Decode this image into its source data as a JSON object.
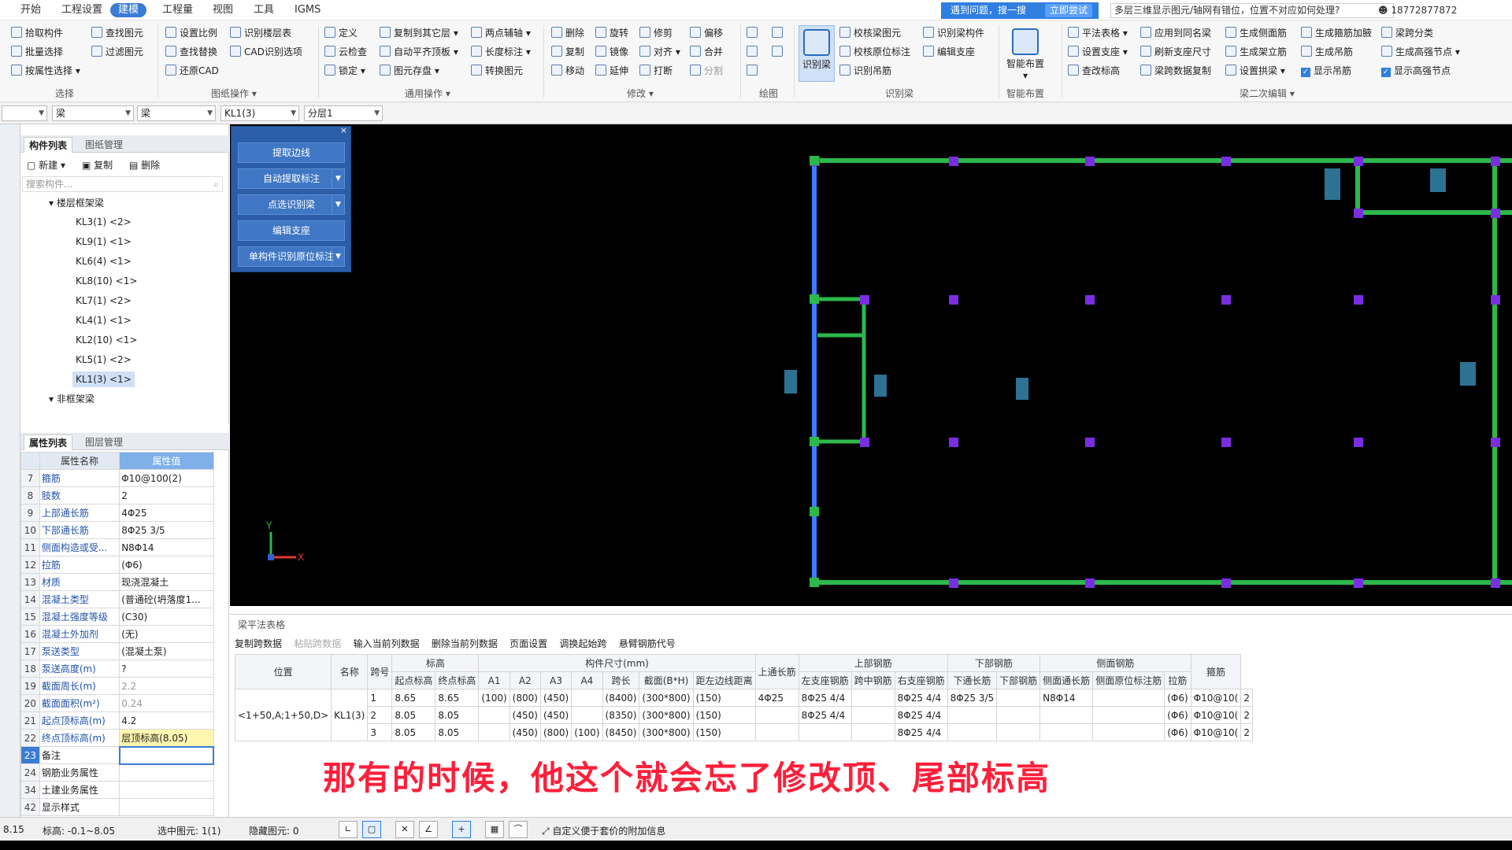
{
  "menu": [
    "开始",
    "工程设置",
    "建模",
    "工程量",
    "视图",
    "工具",
    "IGMS"
  ],
  "help": {
    "text": "遇到问题，搜一搜",
    "try_now": "立即尝试",
    "search": "多层三维显示图元/轴网有错位，位置不对应如何处理?",
    "phone": "18772877872"
  },
  "ribbon": {
    "select": {
      "items": [
        "拾取构件",
        "批量选择",
        "按属性选择",
        "查找图元",
        "过滤图元"
      ],
      "label": "选择"
    },
    "drawing": {
      "items": [
        "设置比例",
        "查找替换",
        "还原CAD",
        "识别楼层表",
        "CAD识别选项"
      ],
      "label": "图纸操作"
    },
    "general": {
      "items": [
        "定义",
        "云检查",
        "锁定",
        "复制到其它层",
        "自动平齐顶板",
        "图元存盘",
        "两点辅轴",
        "长度标注",
        "转换图元"
      ],
      "label": "通用操作"
    },
    "modify": {
      "items": [
        "删除",
        "复制",
        "移动",
        "旋转",
        "镜像",
        "延伸",
        "修剪",
        "对齐",
        "打断",
        "偏移",
        "合并",
        "分割"
      ],
      "label": "修改"
    },
    "draw": {
      "label": "绘图"
    },
    "recognize": {
      "big": "识别梁",
      "items": [
        "校核梁图元",
        "校核原位标注",
        "识别吊筋",
        "识别梁构件",
        "编辑支座"
      ],
      "label": "识别梁"
    },
    "smart": {
      "big": "智能布置",
      "label": "智能布置"
    },
    "beam2": {
      "items": [
        "平法表格",
        "设置支座",
        "查改标高",
        "应用到同名梁",
        "刷新支座尺寸",
        "梁跨数据复制",
        "生成侧面筋",
        "生成架立筋",
        "设置拱梁",
        "生成箍筋加腋",
        "生成吊筋",
        "显示吊筋",
        "梁跨分类",
        "生成高强节点",
        "显示高强节点"
      ],
      "label": "梁二次编辑"
    }
  },
  "selectors": [
    "",
    "梁",
    "梁",
    "KL1(3)",
    "分层1"
  ],
  "comp_panel": {
    "tabs": [
      "构件列表",
      "图纸管理"
    ],
    "tools": [
      "新建",
      "复制",
      "删除"
    ],
    "search_placeholder": "搜索构件...",
    "tree_group": "楼层框架梁",
    "tree_items": [
      "KL3(1) <2>",
      "KL9(1) <1>",
      "KL6(4) <1>",
      "KL8(10) <1>",
      "KL7(1) <2>",
      "KL4(1) <1>",
      "KL2(10) <1>",
      "KL5(1) <2>",
      "KL1(3) <1>"
    ],
    "tree_group2": "非框架梁"
  },
  "prop_panel": {
    "tabs": [
      "属性列表",
      "图层管理"
    ],
    "header": {
      "name": "属性名称",
      "value": "属性值"
    },
    "rows": [
      {
        "n": "7",
        "k": "箍筋",
        "v": "Φ10@100(2)"
      },
      {
        "n": "8",
        "k": "肢数",
        "v": "2"
      },
      {
        "n": "9",
        "k": "上部通长筋",
        "v": "4Φ25"
      },
      {
        "n": "10",
        "k": "下部通长筋",
        "v": "8Φ25 3/5"
      },
      {
        "n": "11",
        "k": "侧面构造或受...",
        "v": "N8Φ14"
      },
      {
        "n": "12",
        "k": "拉筋",
        "v": "(Φ6)"
      },
      {
        "n": "13",
        "k": "材质",
        "v": "现浇混凝土"
      },
      {
        "n": "14",
        "k": "混凝土类型",
        "v": "(普通砼(坍落度1..."
      },
      {
        "n": "15",
        "k": "混凝土强度等级",
        "v": "(C30)"
      },
      {
        "n": "16",
        "k": "混凝土外加剂",
        "v": "(无)"
      },
      {
        "n": "17",
        "k": "泵送类型",
        "v": "(混凝土泵)"
      },
      {
        "n": "18",
        "k": "泵送高度(m)",
        "v": "?"
      },
      {
        "n": "19",
        "k": "截面周长(m)",
        "v": "2.2"
      },
      {
        "n": "20",
        "k": "截面面积(m²)",
        "v": "0.24"
      },
      {
        "n": "21",
        "k": "起点顶标高(m)",
        "v": "4.2"
      },
      {
        "n": "22",
        "k": "终点顶标高(m)",
        "v": "层顶标高(8.05)"
      },
      {
        "n": "23",
        "k": "备注",
        "v": ""
      },
      {
        "n": "24",
        "k": "钢筋业务属性",
        "v": ""
      },
      {
        "n": "34",
        "k": "土建业务属性",
        "v": ""
      },
      {
        "n": "42",
        "k": "显示样式",
        "v": ""
      }
    ]
  },
  "rec_panel": [
    "提取边线",
    "自动提取标注",
    "点选识别梁",
    "编辑支座",
    "单构件识别原位标注"
  ],
  "canvas": {
    "axis_x": "X",
    "axis_y": "Y"
  },
  "beam_table": {
    "title": "梁平法表格",
    "tools": [
      "复制跨数据",
      "粘贴跨数据",
      "输入当前列数据",
      "删除当前列数据",
      "页面设置",
      "调换起始跨",
      "悬臂钢筋代号"
    ],
    "h1": [
      "位置",
      "名称",
      "跨号",
      "标高",
      "构件尺寸(mm)",
      "上通长筋",
      "上部钢筋",
      "下部钢筋",
      "侧面钢筋",
      "箍筋"
    ],
    "h2": [
      "起点标高",
      "终点标高",
      "A1",
      "A2",
      "A3",
      "A4",
      "跨长",
      "截面(B*H)",
      "距左边线距离",
      "左支座钢筋",
      "跨中钢筋",
      "右支座钢筋",
      "下通长筋",
      "下部钢筋",
      "侧面通长筋",
      "侧面原位标注筋",
      "拉筋"
    ],
    "rows": [
      {
        "n": "1",
        "pos": "<1+50,A;1+50,D>",
        "name": "KL1(3)",
        "span": "1",
        "s": "8.65",
        "e": "8.65",
        "a1": "(100)",
        "a2": "(800)",
        "a3": "(450)",
        "a4": "",
        "len": "(8400)",
        "sec": "(300*800)",
        "dist": "(150)",
        "top": "4Φ25",
        "left": "8Φ25 4/4",
        "mid": "",
        "right": "8Φ25 4/4",
        "bot": "8Φ25 3/5",
        "botr": "",
        "side": "N8Φ14",
        "sider": "",
        "tie": "(Φ6)",
        "stir": "Φ10@10("
      },
      {
        "n": "2",
        "pos": "",
        "name": "",
        "span": "2",
        "s": "8.05",
        "e": "8.05",
        "a1": "",
        "a2": "(450)",
        "a3": "(450)",
        "a4": "",
        "len": "(8350)",
        "sec": "(300*800)",
        "dist": "(150)",
        "top": "",
        "left": "8Φ25 4/4",
        "mid": "",
        "right": "8Φ25 4/4",
        "bot": "",
        "botr": "",
        "side": "",
        "sider": "",
        "tie": "(Φ6)",
        "stir": "Φ10@10("
      },
      {
        "n": "3",
        "pos": "",
        "name": "",
        "span": "3",
        "s": "8.05",
        "e": "8.05",
        "a1": "",
        "a2": "(450)",
        "a3": "(800)",
        "a4": "(100)",
        "len": "(8450)",
        "sec": "(300*800)",
        "dist": "(150)",
        "top": "",
        "left": "",
        "mid": "",
        "right": "8Φ25 4/4",
        "bot": "",
        "botr": "",
        "side": "",
        "sider": "",
        "tie": "(Φ6)",
        "stir": "Φ10@10("
      }
    ],
    "extra_col": [
      "2",
      "2",
      "2"
    ]
  },
  "subtitle": "那有的时候，他这个就会忘了修改顶、尾部标高",
  "status": {
    "coord": "8.15",
    "elev": "标高: -0.1~8.05",
    "selected": "选中图元: 1(1)",
    "hidden": "隐藏图元: 0",
    "hint": "自定义便于套价的附加信息"
  }
}
